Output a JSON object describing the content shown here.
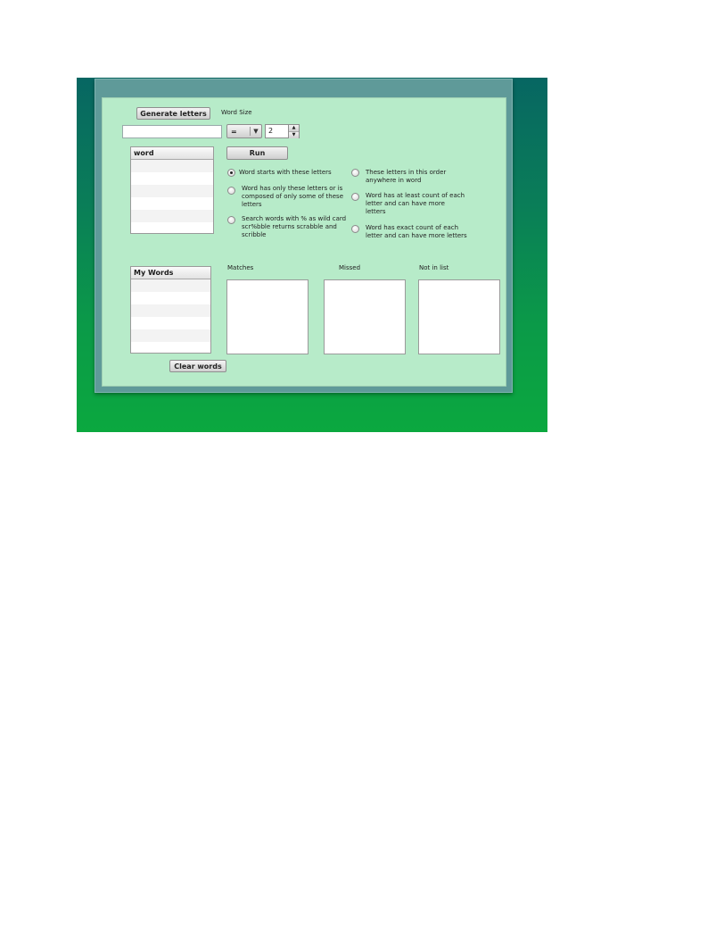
{
  "top": {
    "generate_label": "Generate letters",
    "word_size_label": "Word Size",
    "letters_value": "",
    "operator_value": "=",
    "size_value": "2",
    "run_label": "Run"
  },
  "word_list": {
    "header": "word",
    "rows": [
      "",
      "",
      "",
      "",
      "",
      "",
      ""
    ]
  },
  "options": {
    "left": [
      {
        "label": "Word starts with these letters",
        "checked": true
      },
      {
        "label": "Word has only these letters or is composed of only some of these letters",
        "checked": false
      },
      {
        "label": "Search words with % as wild card  scr%bble returns scrabble and scribble",
        "checked": false
      }
    ],
    "right": [
      {
        "label": "These letters in this order anywhere in word",
        "checked": false
      },
      {
        "label": "Word has at least count of each letter and can have more letters",
        "checked": false
      },
      {
        "label": "Word has exact count of each letter and can have more letters",
        "checked": false
      }
    ]
  },
  "my_words": {
    "header": "My Words",
    "rows": [
      "",
      "",
      "",
      "",
      "",
      ""
    ],
    "clear_label": "Clear words"
  },
  "results": {
    "matches_label": "Matches",
    "missed_label": "Missed",
    "not_in_list_label": "Not in list"
  },
  "colors": {
    "panel": "#b7ebc9",
    "background_top": "#076662",
    "background_bottom": "#0ba83f"
  }
}
